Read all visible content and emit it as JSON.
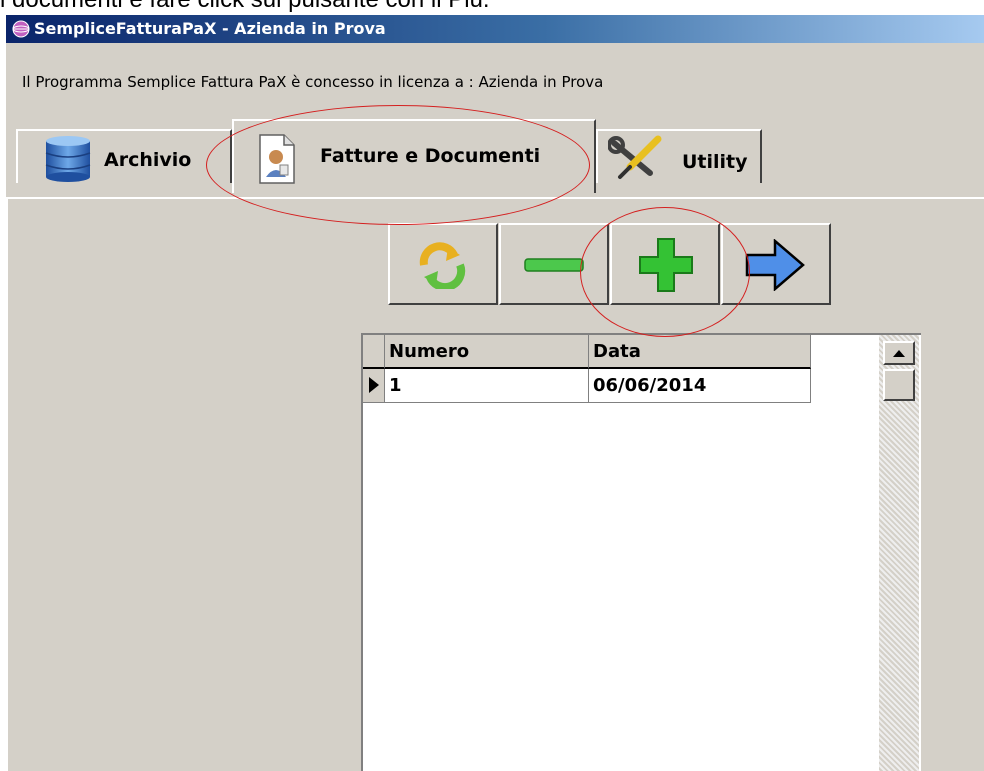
{
  "caption": "i documenti e fare click sul pulsante con il Più.",
  "window": {
    "title": "SempliceFatturaPaX - Azienda in Prova"
  },
  "license_text": "Il Programma Semplice Fattura PaX è concesso in licenza a : Azienda in Prova",
  "tabs": [
    {
      "label": "Archivio",
      "icon": "database-icon",
      "active": false
    },
    {
      "label": "Fatture e Documenti",
      "icon": "document-icon",
      "active": true
    },
    {
      "label": "Utility",
      "icon": "tools-icon",
      "active": false
    }
  ],
  "toolbar": {
    "refresh_icon": "refresh-icon",
    "remove_icon": "minus-icon",
    "add_icon": "plus-icon",
    "next_icon": "arrow-right-icon"
  },
  "grid": {
    "columns": [
      "Numero",
      "Data"
    ],
    "rows": [
      {
        "numero": "1",
        "data": "06/06/2014"
      }
    ]
  },
  "colors": {
    "annotation": "#d42020",
    "add_green": "#2fbf2f",
    "arrow_blue": "#4f8fe8"
  }
}
